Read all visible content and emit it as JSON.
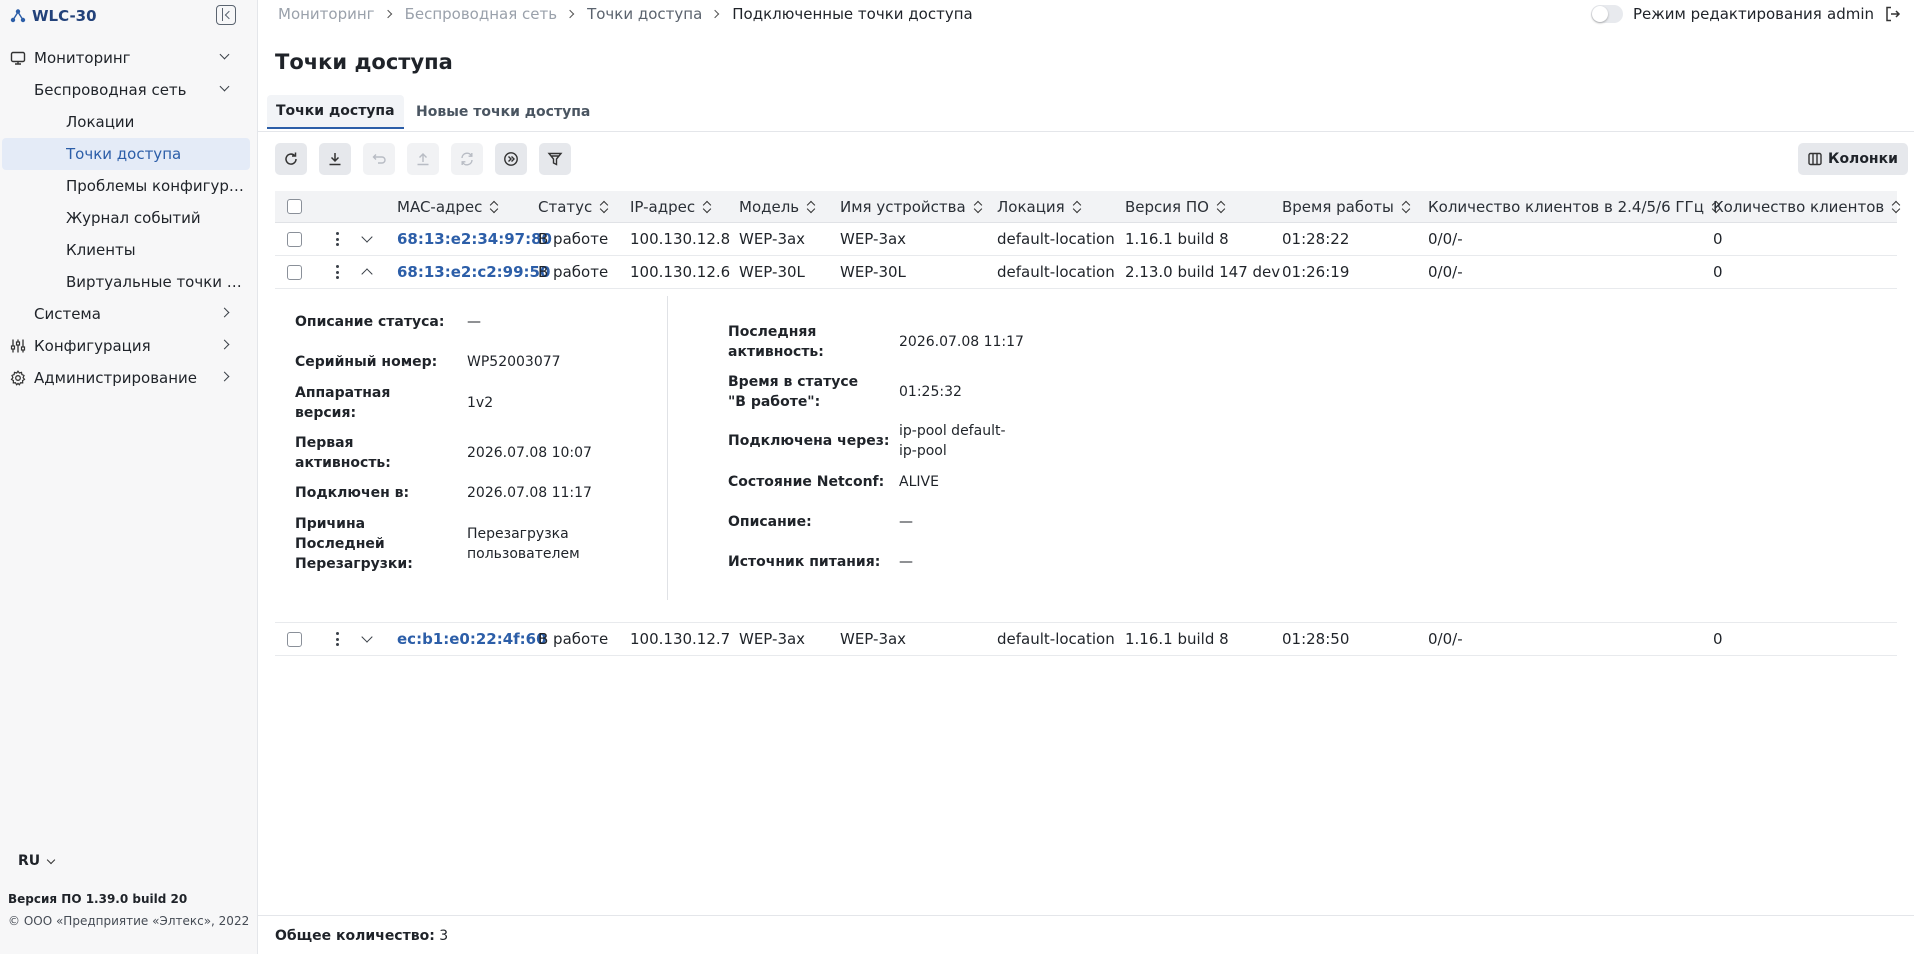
{
  "app": {
    "name": "WLC-30",
    "software_version": "Версия ПО 1.39.0 build 20",
    "copyright": "© ООО «Предприятие «Элтекс», 2022",
    "language": "RU"
  },
  "sidebar": {
    "items": [
      {
        "label": "Мониторинг",
        "level": 0,
        "icon": "monitor-icon",
        "chevron": "down"
      },
      {
        "label": "Беспроводная сеть",
        "level": 1,
        "chevron": "down"
      },
      {
        "label": "Локации",
        "level": 2
      },
      {
        "label": "Точки доступа",
        "level": 2,
        "active": true
      },
      {
        "label": "Проблемы конфигурации",
        "level": 2
      },
      {
        "label": "Журнал событий",
        "level": 2
      },
      {
        "label": "Клиенты",
        "level": 2
      },
      {
        "label": "Виртуальные точки доступа",
        "level": 2
      },
      {
        "label": "Система",
        "level": 1,
        "chevron": "right"
      },
      {
        "label": "Конфигурация",
        "level": 0,
        "icon": "sliders-icon",
        "chevron": "right"
      },
      {
        "label": "Администрирование",
        "level": 0,
        "icon": "gear-icon",
        "chevron": "right"
      }
    ]
  },
  "breadcrumb": [
    "Мониторинг",
    "Беспроводная сеть",
    "Точки доступа",
    "Подключенные точки доступа"
  ],
  "topbar": {
    "edit_mode_label": "Режим редактирования",
    "user": "admin"
  },
  "page": {
    "title": "Точки доступа"
  },
  "tabs": [
    {
      "label": "Точки доступа",
      "active": true
    },
    {
      "label": "Новые точки доступа",
      "active": false
    }
  ],
  "toolbar": {
    "buttons": [
      {
        "name": "refresh-button",
        "icon": "refresh-icon",
        "enabled": true
      },
      {
        "name": "download-button",
        "icon": "download-icon",
        "enabled": true
      },
      {
        "name": "reboot-button",
        "icon": "reboot-icon",
        "enabled": false
      },
      {
        "name": "upload-button",
        "icon": "upload-icon",
        "enabled": false
      },
      {
        "name": "sync-button",
        "icon": "sync-icon",
        "enabled": false
      },
      {
        "name": "forward-button",
        "icon": "fast-forward-icon",
        "enabled": true
      },
      {
        "name": "filter-button",
        "icon": "filter-icon",
        "enabled": true
      }
    ],
    "columns_label": "Колонки"
  },
  "table": {
    "columns": [
      "MAC-адрес",
      "Статус",
      "IP-адрес",
      "Модель",
      "Имя устройства",
      "Локация",
      "Версия ПО",
      "Время работы",
      "Количество клиентов в 2.4/5/6 ГГц",
      "Количество клиентов"
    ],
    "rows": [
      {
        "mac": "68:13:e2:34:97:80",
        "status": "В работе",
        "ip": "100.130.12.8",
        "model": "WEP-3ax",
        "name": "WEP-3ax",
        "location": "default-location",
        "version": "1.16.1 build 8",
        "uptime": "01:28:22",
        "clients_bands": "0/0/-",
        "clients": "0"
      },
      {
        "mac": "68:13:e2:c2:99:50",
        "status": "В работе",
        "ip": "100.130.12.6",
        "model": "WEP-30L",
        "name": "WEP-30L",
        "location": "default-location",
        "version": "2.13.0 build 147 dev",
        "uptime": "01:26:19",
        "clients_bands": "0/0/-",
        "clients": "0"
      },
      {
        "mac": "ec:b1:e0:22:4f:60",
        "status": "В работе",
        "ip": "100.130.12.7",
        "model": "WEP-3ax",
        "name": "WEP-3ax",
        "location": "default-location",
        "version": "1.16.1 build 8",
        "uptime": "01:28:50",
        "clients_bands": "0/0/-",
        "clients": "0"
      }
    ]
  },
  "details": {
    "left": [
      {
        "label": "Описание статуса:",
        "value": "—"
      },
      {
        "label": "Серийный номер:",
        "value": "WP52003077"
      },
      {
        "label": "Аппаратная версия:",
        "value": "1v2"
      },
      {
        "label": "Первая активность:",
        "value": "2026.07.08 10:07"
      },
      {
        "label": "Подключен в:",
        "value": "2026.07.08 11:17"
      },
      {
        "label": "Причина Последней Перезагрузки:",
        "value": "Перезагрузка пользователем"
      }
    ],
    "right": [
      {
        "label": "Последняя активность:",
        "value": "2026.07.08 11:17"
      },
      {
        "label": "Время в статусе \"В работе\":",
        "value": "01:25:32"
      },
      {
        "label": "Подключена через:",
        "value": "ip-pool default-ip-pool"
      },
      {
        "label": "Состояние Netconf:",
        "value": "ALIVE"
      },
      {
        "label": "Описание:",
        "value": "—"
      },
      {
        "label": "Источник питания:",
        "value": "—"
      }
    ]
  },
  "footer": {
    "total_label": "Общее количество:",
    "total_value": "3"
  }
}
